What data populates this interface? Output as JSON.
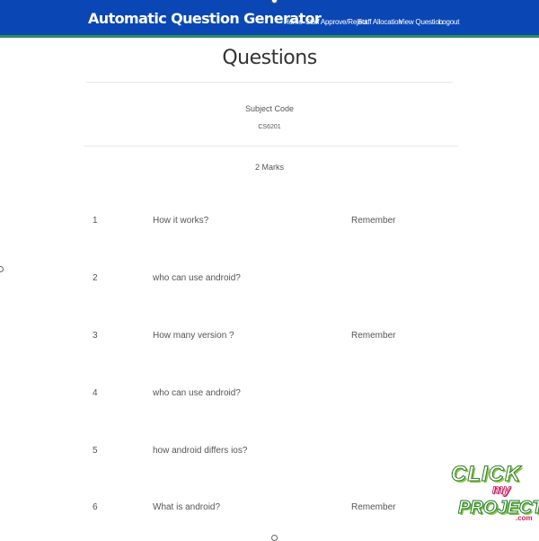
{
  "navbar": {
    "brand": "Automatic Question Generator",
    "links": [
      "Home",
      "Staff Approve/Reject",
      "Staff Allocation",
      "View Question",
      "Logout"
    ]
  },
  "page": {
    "title": "Questions",
    "subject_label": "Subject Code",
    "subject_code": "CS6201",
    "marks_heading": "2 Marks"
  },
  "questions": [
    {
      "num": "1",
      "text": "How it works?",
      "level": "Remember"
    },
    {
      "num": "2",
      "text": "who can use android?",
      "level": ""
    },
    {
      "num": "3",
      "text": "How many version ?",
      "level": "Remember"
    },
    {
      "num": "4",
      "text": "who can use android?",
      "level": ""
    },
    {
      "num": "5",
      "text": "how android differs ios?",
      "level": ""
    },
    {
      "num": "6",
      "text": "What is android?",
      "level": "Remember"
    }
  ],
  "watermark": {
    "line1": "CLICK",
    "line2": "my",
    "line3": "PROJECT",
    "line4": ".com"
  },
  "colors": {
    "navbar_bg": "#0a47b5",
    "navbar_border": "#2f8c5a",
    "text": "#555555"
  }
}
